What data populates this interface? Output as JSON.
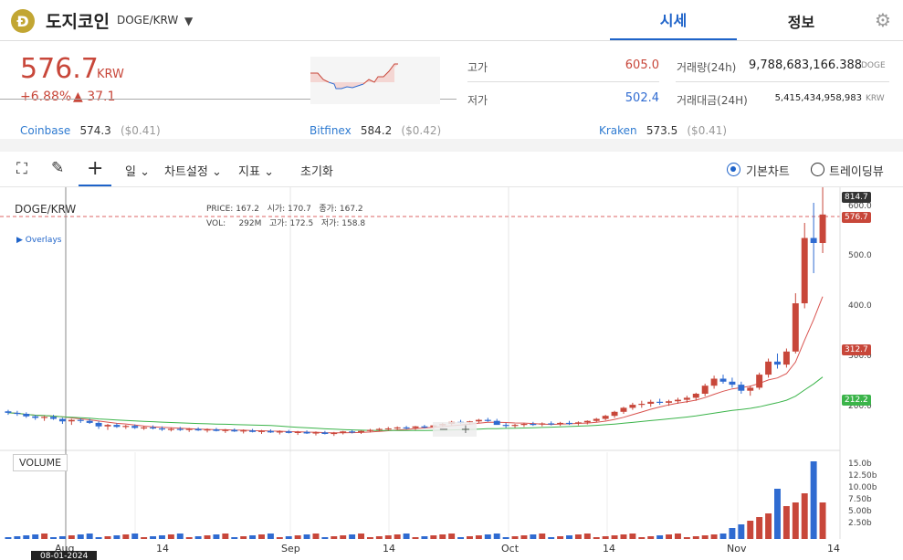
{
  "header": {
    "coin_symbol_badge": "Đ",
    "coin_name": "도지코인",
    "pair": "DOGE/KRW",
    "tabs": [
      {
        "label": "시세",
        "active": true
      },
      {
        "label": "정보",
        "active": false
      }
    ],
    "settings_icon": "gear-icon",
    "accent_color": "#1e63c9"
  },
  "price": {
    "value": "576.7",
    "unit": "KRW",
    "change_pct": "+6.88%",
    "change_abs": "37.1",
    "change_arrow": "▲",
    "up_color": "#c8473a",
    "down_color": "#2f6bd1"
  },
  "stats": {
    "high_label": "고가",
    "high_value": "605.0",
    "low_label": "저가",
    "low_value": "502.4",
    "volume_label": "거래량(24h)",
    "volume_value": "9,788,683,166.388",
    "volume_unit": "DOGE",
    "amount_label": "거래대금(24H)",
    "amount_value": "5,415,434,958,983",
    "amount_unit": "KRW"
  },
  "exchanges": [
    {
      "name": "Coinbase",
      "price": "574.3",
      "usd": "($0.41)"
    },
    {
      "name": "Bitfinex",
      "price": "584.2",
      "usd": "($0.42)"
    },
    {
      "name": "Kraken",
      "price": "573.5",
      "usd": "($0.41)"
    }
  ],
  "toolbar": {
    "interval_label": "일",
    "chart_settings_label": "차트설정",
    "indicator_label": "지표",
    "reset_label": "초기화",
    "basic_chart_label": "기본차트",
    "tradingview_label": "트레이딩뷰",
    "selected_chart": "기본차트"
  },
  "chart": {
    "pair_label": "DOGE/KRW",
    "overlays_label": "▶ Overlays",
    "ohlc": {
      "price_label": "PRICE:",
      "price": "167.2",
      "open_label": "시가:",
      "open": "170.7",
      "close_label": "종가:",
      "close": "167.2",
      "vol_label": "VOL:",
      "vol": "292M",
      "high_label": "고가:",
      "high": "172.5",
      "low_label": "저가:",
      "low": "158.8"
    },
    "y_ticks": [
      "600.0",
      "500.0",
      "400.0",
      "300.0",
      "200.0"
    ],
    "tags": {
      "high_tag": "814.7",
      "price_tag": "576.7",
      "ma_red_tag": "312.7",
      "ma_green_tag": "212.2"
    },
    "volume_label": "VOLUME",
    "vol_ticks": [
      "15.0b",
      "12.50b",
      "10.00b",
      "7.50b",
      "5.00b",
      "2.50b"
    ],
    "x_labels": [
      "Aug",
      "14",
      "Sep",
      "14",
      "Oct",
      "14",
      "Nov",
      "14"
    ],
    "cursor_date": "08-01-2024",
    "zoom_minus": "−",
    "zoom_plus": "+"
  },
  "chart_data": {
    "type": "candlestick",
    "ylim": [
      120,
      830
    ],
    "candles": [
      [
        185,
        188,
        178,
        182
      ],
      [
        182,
        186,
        176,
        180
      ],
      [
        180,
        183,
        172,
        175
      ],
      [
        175,
        178,
        168,
        172
      ],
      [
        172,
        176,
        166,
        174
      ],
      [
        174,
        178,
        168,
        170
      ],
      [
        170,
        172,
        160,
        165
      ],
      [
        165,
        170,
        158,
        168
      ],
      [
        168,
        171,
        162,
        166
      ],
      [
        166,
        170,
        160,
        162
      ],
      [
        162,
        165,
        150,
        155
      ],
      [
        155,
        160,
        148,
        158
      ],
      [
        158,
        161,
        152,
        154
      ],
      [
        154,
        158,
        150,
        156
      ],
      [
        156,
        159,
        150,
        152
      ],
      [
        152,
        156,
        148,
        153
      ],
      [
        153,
        157,
        149,
        151
      ],
      [
        151,
        155,
        146,
        149
      ],
      [
        149,
        153,
        145,
        150
      ],
      [
        150,
        154,
        146,
        148
      ],
      [
        148,
        152,
        144,
        150
      ],
      [
        150,
        153,
        146,
        147
      ],
      [
        147,
        151,
        143,
        149
      ],
      [
        149,
        152,
        145,
        146
      ],
      [
        146,
        150,
        142,
        148
      ],
      [
        148,
        151,
        144,
        145
      ],
      [
        145,
        149,
        141,
        147
      ],
      [
        147,
        150,
        143,
        144
      ],
      [
        144,
        148,
        140,
        146
      ],
      [
        146,
        149,
        142,
        143
      ],
      [
        143,
        147,
        139,
        145
      ],
      [
        145,
        148,
        141,
        142
      ],
      [
        142,
        146,
        138,
        144
      ],
      [
        144,
        147,
        140,
        141
      ],
      [
        141,
        145,
        137,
        143
      ],
      [
        143,
        146,
        139,
        140
      ],
      [
        140,
        144,
        136,
        142
      ],
      [
        142,
        146,
        139,
        145
      ],
      [
        145,
        148,
        141,
        143
      ],
      [
        143,
        147,
        140,
        146
      ],
      [
        146,
        150,
        143,
        148
      ],
      [
        148,
        152,
        145,
        150
      ],
      [
        150,
        154,
        147,
        151
      ],
      [
        151,
        155,
        148,
        153
      ],
      [
        153,
        156,
        149,
        152
      ],
      [
        152,
        156,
        148,
        155
      ],
      [
        155,
        158,
        151,
        154
      ],
      [
        154,
        158,
        150,
        157
      ],
      [
        157,
        162,
        154,
        160
      ],
      [
        160,
        166,
        157,
        164
      ],
      [
        164,
        168,
        160,
        162
      ],
      [
        162,
        166,
        158,
        165
      ],
      [
        165,
        170,
        162,
        168
      ],
      [
        168,
        172,
        164,
        166
      ],
      [
        166,
        170,
        160,
        158
      ],
      [
        158,
        162,
        152,
        156
      ],
      [
        156,
        160,
        152,
        158
      ],
      [
        158,
        162,
        154,
        160
      ],
      [
        160,
        164,
        156,
        159
      ],
      [
        159,
        163,
        155,
        161
      ],
      [
        161,
        165,
        157,
        160
      ],
      [
        160,
        164,
        156,
        162
      ],
      [
        162,
        166,
        158,
        161
      ],
      [
        161,
        165,
        157,
        163
      ],
      [
        163,
        167,
        159,
        166
      ],
      [
        166,
        172,
        163,
        170
      ],
      [
        170,
        178,
        167,
        176
      ],
      [
        176,
        186,
        172,
        184
      ],
      [
        184,
        194,
        180,
        192
      ],
      [
        192,
        202,
        188,
        198
      ],
      [
        198,
        206,
        192,
        200
      ],
      [
        200,
        208,
        194,
        204
      ],
      [
        204,
        210,
        198,
        202
      ],
      [
        202,
        208,
        196,
        205
      ],
      [
        205,
        212,
        200,
        208
      ],
      [
        208,
        216,
        202,
        212
      ],
      [
        212,
        222,
        206,
        220
      ],
      [
        220,
        240,
        215,
        236
      ],
      [
        236,
        256,
        230,
        250
      ],
      [
        250,
        258,
        240,
        244
      ],
      [
        244,
        252,
        232,
        238
      ],
      [
        238,
        244,
        220,
        226
      ],
      [
        226,
        236,
        216,
        232
      ],
      [
        232,
        262,
        228,
        258
      ],
      [
        258,
        290,
        252,
        284
      ],
      [
        284,
        300,
        270,
        278
      ],
      [
        278,
        310,
        272,
        304
      ],
      [
        304,
        420,
        300,
        400
      ],
      [
        400,
        560,
        390,
        530
      ],
      [
        530,
        600,
        460,
        520
      ],
      [
        520,
        830,
        500,
        576.7
      ]
    ],
    "ma_red_end": 312.7,
    "ma_green_end": 212.2
  }
}
